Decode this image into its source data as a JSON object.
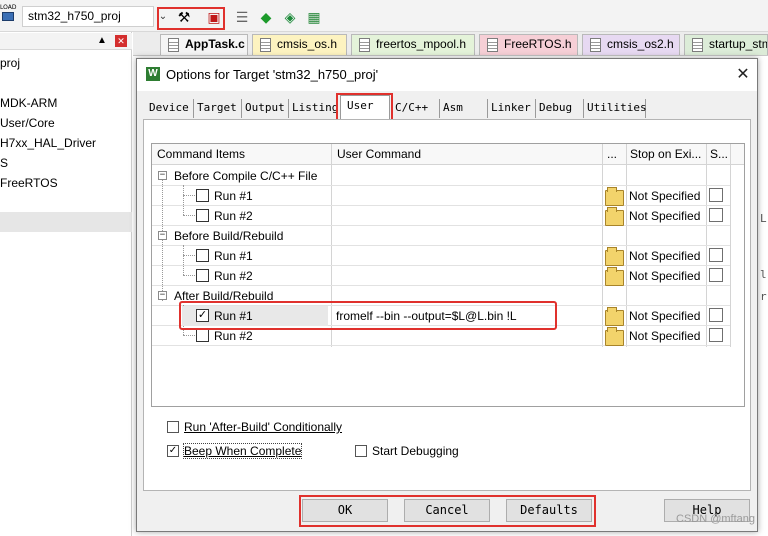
{
  "toolbar": {
    "load_label": "LOAD",
    "target_name": "stm32_h750_proj",
    "icons": [
      "load-icon",
      "target-options-icon",
      "manage-components-icon",
      "stack-icon",
      "green-diamond-icon",
      "arrow-diamond-icon",
      "pack-installer-icon"
    ]
  },
  "left_pane": {
    "items": [
      "proj",
      "MDK-ARM",
      "User/Core",
      "H7xx_HAL_Driver",
      "S",
      "FreeRTOS"
    ]
  },
  "editor_tabs": [
    {
      "label": "AppTask.c",
      "active": true,
      "color": "#f5f5f5"
    },
    {
      "label": "cmsis_os.h",
      "active": false,
      "color": "#fdf3c0"
    },
    {
      "label": "freertos_mpool.h",
      "active": false,
      "color": "#e4f3d9"
    },
    {
      "label": "FreeRTOS.h",
      "active": false,
      "color": "#f6cfd6"
    },
    {
      "label": "cmsis_os2.h",
      "active": false,
      "color": "#e7d9f2"
    },
    {
      "label": "startup_stm",
      "active": false,
      "color": "#dcecd8"
    }
  ],
  "dialog": {
    "title": "Options for Target 'stm32_h750_proj'",
    "tabs": [
      "Device",
      "Target",
      "Output",
      "Listing",
      "User",
      "C/C++",
      "Asm",
      "Linker",
      "Debug",
      "Utilities"
    ],
    "active_tab": "User",
    "grid": {
      "columns": [
        "Command Items",
        "User Command",
        "...",
        "Stop on Exi...",
        "S..."
      ],
      "groups": [
        {
          "label": "Before Compile C/C++ File",
          "runs": [
            {
              "label": "Run #1",
              "checked": false,
              "command": "",
              "stop": "Not Specified"
            },
            {
              "label": "Run #2",
              "checked": false,
              "command": "",
              "stop": "Not Specified"
            }
          ]
        },
        {
          "label": "Before Build/Rebuild",
          "runs": [
            {
              "label": "Run #1",
              "checked": false,
              "command": "",
              "stop": "Not Specified"
            },
            {
              "label": "Run #2",
              "checked": false,
              "command": "",
              "stop": "Not Specified"
            }
          ]
        },
        {
          "label": "After Build/Rebuild",
          "runs": [
            {
              "label": "Run #1",
              "checked": true,
              "command": "fromelf --bin --output=$L@L.bin !L",
              "stop": "Not Specified"
            },
            {
              "label": "Run #2",
              "checked": false,
              "command": "",
              "stop": "Not Specified"
            }
          ]
        }
      ]
    },
    "options": {
      "run_after_build": {
        "label": "Run 'After-Build' Conditionally",
        "checked": false
      },
      "beep": {
        "label": "Beep When Complete",
        "checked": true
      },
      "start_debugging": {
        "label": "Start Debugging",
        "checked": false
      }
    },
    "buttons": {
      "ok": "OK",
      "cancel": "Cancel",
      "defaults": "Defaults",
      "help": "Help"
    }
  },
  "watermark": "CSDN @mftang",
  "highlight_color": "#e0312d"
}
